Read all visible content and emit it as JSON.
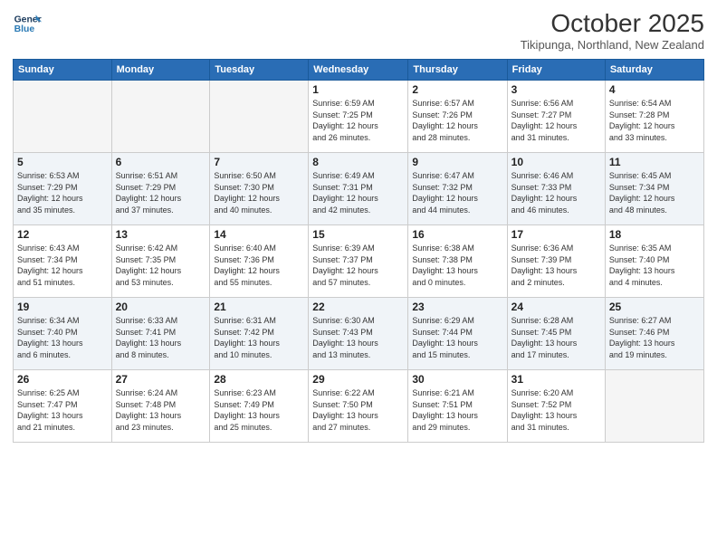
{
  "header": {
    "logo_line1": "General",
    "logo_line2": "Blue",
    "month": "October 2025",
    "location": "Tikipunga, Northland, New Zealand"
  },
  "days_of_week": [
    "Sunday",
    "Monday",
    "Tuesday",
    "Wednesday",
    "Thursday",
    "Friday",
    "Saturday"
  ],
  "weeks": [
    {
      "alt": false,
      "days": [
        {
          "num": "",
          "info": ""
        },
        {
          "num": "",
          "info": ""
        },
        {
          "num": "",
          "info": ""
        },
        {
          "num": "1",
          "info": "Sunrise: 6:59 AM\nSunset: 7:25 PM\nDaylight: 12 hours\nand 26 minutes."
        },
        {
          "num": "2",
          "info": "Sunrise: 6:57 AM\nSunset: 7:26 PM\nDaylight: 12 hours\nand 28 minutes."
        },
        {
          "num": "3",
          "info": "Sunrise: 6:56 AM\nSunset: 7:27 PM\nDaylight: 12 hours\nand 31 minutes."
        },
        {
          "num": "4",
          "info": "Sunrise: 6:54 AM\nSunset: 7:28 PM\nDaylight: 12 hours\nand 33 minutes."
        }
      ]
    },
    {
      "alt": true,
      "days": [
        {
          "num": "5",
          "info": "Sunrise: 6:53 AM\nSunset: 7:29 PM\nDaylight: 12 hours\nand 35 minutes."
        },
        {
          "num": "6",
          "info": "Sunrise: 6:51 AM\nSunset: 7:29 PM\nDaylight: 12 hours\nand 37 minutes."
        },
        {
          "num": "7",
          "info": "Sunrise: 6:50 AM\nSunset: 7:30 PM\nDaylight: 12 hours\nand 40 minutes."
        },
        {
          "num": "8",
          "info": "Sunrise: 6:49 AM\nSunset: 7:31 PM\nDaylight: 12 hours\nand 42 minutes."
        },
        {
          "num": "9",
          "info": "Sunrise: 6:47 AM\nSunset: 7:32 PM\nDaylight: 12 hours\nand 44 minutes."
        },
        {
          "num": "10",
          "info": "Sunrise: 6:46 AM\nSunset: 7:33 PM\nDaylight: 12 hours\nand 46 minutes."
        },
        {
          "num": "11",
          "info": "Sunrise: 6:45 AM\nSunset: 7:34 PM\nDaylight: 12 hours\nand 48 minutes."
        }
      ]
    },
    {
      "alt": false,
      "days": [
        {
          "num": "12",
          "info": "Sunrise: 6:43 AM\nSunset: 7:34 PM\nDaylight: 12 hours\nand 51 minutes."
        },
        {
          "num": "13",
          "info": "Sunrise: 6:42 AM\nSunset: 7:35 PM\nDaylight: 12 hours\nand 53 minutes."
        },
        {
          "num": "14",
          "info": "Sunrise: 6:40 AM\nSunset: 7:36 PM\nDaylight: 12 hours\nand 55 minutes."
        },
        {
          "num": "15",
          "info": "Sunrise: 6:39 AM\nSunset: 7:37 PM\nDaylight: 12 hours\nand 57 minutes."
        },
        {
          "num": "16",
          "info": "Sunrise: 6:38 AM\nSunset: 7:38 PM\nDaylight: 13 hours\nand 0 minutes."
        },
        {
          "num": "17",
          "info": "Sunrise: 6:36 AM\nSunset: 7:39 PM\nDaylight: 13 hours\nand 2 minutes."
        },
        {
          "num": "18",
          "info": "Sunrise: 6:35 AM\nSunset: 7:40 PM\nDaylight: 13 hours\nand 4 minutes."
        }
      ]
    },
    {
      "alt": true,
      "days": [
        {
          "num": "19",
          "info": "Sunrise: 6:34 AM\nSunset: 7:40 PM\nDaylight: 13 hours\nand 6 minutes."
        },
        {
          "num": "20",
          "info": "Sunrise: 6:33 AM\nSunset: 7:41 PM\nDaylight: 13 hours\nand 8 minutes."
        },
        {
          "num": "21",
          "info": "Sunrise: 6:31 AM\nSunset: 7:42 PM\nDaylight: 13 hours\nand 10 minutes."
        },
        {
          "num": "22",
          "info": "Sunrise: 6:30 AM\nSunset: 7:43 PM\nDaylight: 13 hours\nand 13 minutes."
        },
        {
          "num": "23",
          "info": "Sunrise: 6:29 AM\nSunset: 7:44 PM\nDaylight: 13 hours\nand 15 minutes."
        },
        {
          "num": "24",
          "info": "Sunrise: 6:28 AM\nSunset: 7:45 PM\nDaylight: 13 hours\nand 17 minutes."
        },
        {
          "num": "25",
          "info": "Sunrise: 6:27 AM\nSunset: 7:46 PM\nDaylight: 13 hours\nand 19 minutes."
        }
      ]
    },
    {
      "alt": false,
      "days": [
        {
          "num": "26",
          "info": "Sunrise: 6:25 AM\nSunset: 7:47 PM\nDaylight: 13 hours\nand 21 minutes."
        },
        {
          "num": "27",
          "info": "Sunrise: 6:24 AM\nSunset: 7:48 PM\nDaylight: 13 hours\nand 23 minutes."
        },
        {
          "num": "28",
          "info": "Sunrise: 6:23 AM\nSunset: 7:49 PM\nDaylight: 13 hours\nand 25 minutes."
        },
        {
          "num": "29",
          "info": "Sunrise: 6:22 AM\nSunset: 7:50 PM\nDaylight: 13 hours\nand 27 minutes."
        },
        {
          "num": "30",
          "info": "Sunrise: 6:21 AM\nSunset: 7:51 PM\nDaylight: 13 hours\nand 29 minutes."
        },
        {
          "num": "31",
          "info": "Sunrise: 6:20 AM\nSunset: 7:52 PM\nDaylight: 13 hours\nand 31 minutes."
        },
        {
          "num": "",
          "info": ""
        }
      ]
    }
  ]
}
